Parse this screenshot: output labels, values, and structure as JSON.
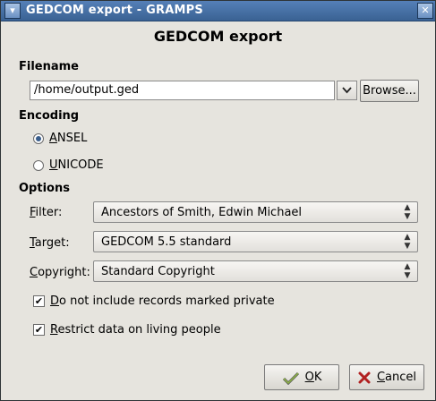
{
  "window": {
    "title": "GEDCOM export - GRAMPS"
  },
  "dialog": {
    "heading": "GEDCOM export"
  },
  "filename": {
    "section_label": "Filename",
    "value": "/home/output.ged",
    "browse_label": "Browse..."
  },
  "encoding": {
    "section_label": "Encoding",
    "options": [
      {
        "mnemonic": "A",
        "rest": "NSEL",
        "selected": true
      },
      {
        "mnemonic": "U",
        "rest": "NICODE",
        "selected": false
      }
    ]
  },
  "options": {
    "section_label": "Options",
    "filter": {
      "mnemonic": "F",
      "rest": "ilter:",
      "value": "Ancestors of Smith, Edwin Michael"
    },
    "target": {
      "mnemonic": "T",
      "rest": "arget:",
      "value": "GEDCOM 5.5 standard"
    },
    "copyright": {
      "mnemonic": "C",
      "rest": "opyright:",
      "value": "Standard Copyright"
    },
    "private_check": {
      "mnemonic": "D",
      "rest": "o not include records marked private",
      "checked": true
    },
    "living_check": {
      "mnemonic": "R",
      "rest": "estrict data on living people",
      "checked": true
    }
  },
  "buttons": {
    "ok": {
      "mnemonic": "O",
      "rest": "K"
    },
    "cancel": {
      "mnemonic": "C",
      "rest": "ancel"
    }
  }
}
